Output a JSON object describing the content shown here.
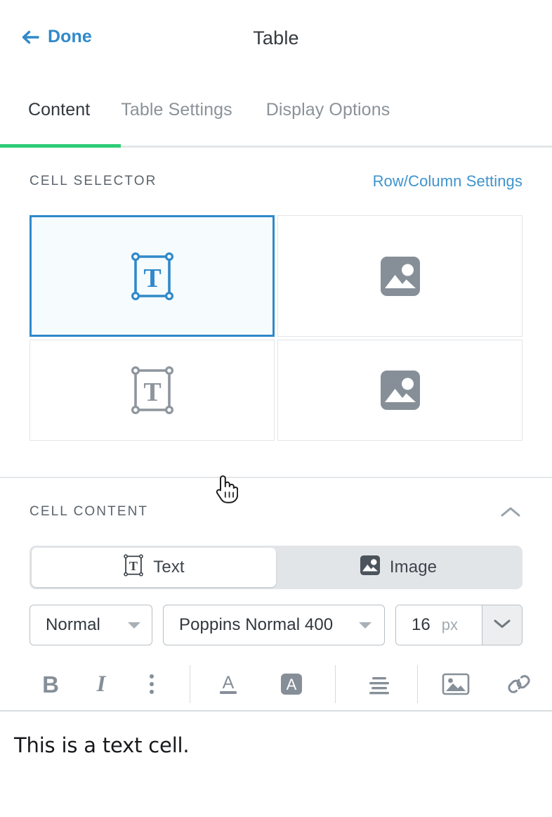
{
  "header": {
    "back_label": "Done",
    "back_icon": "arrow-left-icon",
    "title": "Table"
  },
  "tabs": [
    {
      "label": "Content",
      "active": true
    },
    {
      "label": "Table Settings",
      "active": false
    },
    {
      "label": "Display Options",
      "active": false
    }
  ],
  "cell_selector": {
    "section_title": "CELL SELECTOR",
    "link_label": "Row/Column Settings",
    "cells": [
      {
        "type": "text",
        "icon": "text-cell-icon",
        "selected": true
      },
      {
        "type": "image",
        "icon": "image-cell-icon",
        "selected": false
      },
      {
        "type": "text",
        "icon": "text-cell-icon",
        "selected": false
      },
      {
        "type": "image",
        "icon": "image-cell-icon",
        "selected": false
      }
    ],
    "cursor": "pointer-hand-cursor"
  },
  "cell_content": {
    "section_title": "CELL CONTENT",
    "collapse_icon": "chevron-up-icon",
    "type_toggle": [
      {
        "label": "Text",
        "icon": "text-cell-icon",
        "active": true
      },
      {
        "label": "Image",
        "icon": "image-cell-icon",
        "active": false
      }
    ],
    "controls": {
      "paragraph_style": "Normal",
      "font_family": "Poppins Normal 400",
      "font_size": "16",
      "font_size_unit": "px"
    },
    "toolbar": [
      {
        "name": "bold-icon",
        "glyph": "B"
      },
      {
        "name": "italic-icon",
        "glyph": "I"
      },
      {
        "name": "more-options-icon",
        "glyph": ""
      },
      {
        "name": "text-color-icon",
        "glyph": "A"
      },
      {
        "name": "highlight-color-icon",
        "glyph": "A"
      },
      {
        "name": "align-icon",
        "glyph": ""
      },
      {
        "name": "insert-image-icon",
        "glyph": ""
      },
      {
        "name": "insert-link-icon",
        "glyph": ""
      },
      {
        "name": "insert-person-icon",
        "glyph": ""
      },
      {
        "name": "code-view-icon",
        "glyph": "</>"
      }
    ]
  },
  "editor": {
    "content": "This is a text cell."
  },
  "colors": {
    "accent_green": "#2ecc76",
    "link_blue": "#3089c9",
    "selected_border": "#3089c9",
    "selected_fill": "#f6fbfe",
    "icon_gray": "#868f98",
    "border_gray": "#e2e5e8"
  }
}
